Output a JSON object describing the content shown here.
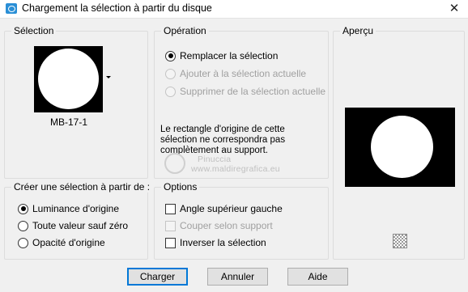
{
  "window": {
    "title": "Chargement la sélection à partir du disque",
    "close_glyph": "✕"
  },
  "selection_group": {
    "legend": "Sélection",
    "file_name": "MB-17-1"
  },
  "operation_group": {
    "legend": "Opération",
    "options": [
      {
        "label": "Remplacer la sélection",
        "checked": true,
        "enabled": true
      },
      {
        "label": "Ajouter à la sélection actuelle",
        "checked": false,
        "enabled": false
      },
      {
        "label": "Supprimer de la sélection actuelle",
        "checked": false,
        "enabled": false
      }
    ],
    "notice": "Le rectangle d'origine de cette sélection ne correspondra pas complètement au support."
  },
  "preview_group": {
    "legend": "Aperçu"
  },
  "create_group": {
    "legend": "Créer une sélection à partir de :",
    "options": [
      {
        "label": "Luminance d'origine",
        "checked": true
      },
      {
        "label": "Toute valeur sauf zéro",
        "checked": false
      },
      {
        "label": "Opacité d'origine",
        "checked": false
      }
    ]
  },
  "options_group": {
    "legend": "Options",
    "items": [
      {
        "label": "Angle supérieur gauche",
        "checked": false,
        "enabled": true
      },
      {
        "label": "Couper selon support",
        "checked": false,
        "enabled": false
      },
      {
        "label": "Inverser la sélection",
        "checked": false,
        "enabled": true
      }
    ]
  },
  "watermark": {
    "line1": "Pinuccia",
    "line2": "www.maldiregrafica.eu"
  },
  "buttons": {
    "load": "Charger",
    "cancel": "Annuler",
    "help": "Aide"
  },
  "icons": {
    "app": "selection-load-icon",
    "close": "close-icon",
    "dropdown": "chevron-down-icon",
    "transparency": "checkerboard-icon"
  }
}
